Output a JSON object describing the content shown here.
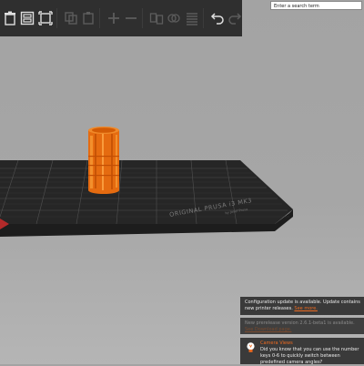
{
  "toolbar": {
    "buttons": [
      {
        "name": "delete-icon",
        "enabled": true
      },
      {
        "name": "delete-all-icon",
        "enabled": true
      },
      {
        "name": "arrange-icon",
        "enabled": true
      },
      {
        "name": "copy-icon",
        "enabled": false
      },
      {
        "name": "paste-icon",
        "enabled": false
      },
      {
        "name": "add-instance-icon",
        "enabled": false
      },
      {
        "name": "remove-instance-icon",
        "enabled": false
      },
      {
        "name": "split-objects-icon",
        "enabled": false
      },
      {
        "name": "split-parts-icon",
        "enabled": false
      },
      {
        "name": "layers-editing-icon",
        "enabled": false
      },
      {
        "name": "undo-icon",
        "enabled": true
      },
      {
        "name": "redo-icon",
        "enabled": false
      }
    ]
  },
  "search": {
    "placeholder": "Enter a search term"
  },
  "bed": {
    "label_main": "ORIGINAL PRUSA i3 MK3",
    "label_sub": "by Josef Prusa"
  },
  "notifications": [
    {
      "text": "Configuration update is available. Update contains new printer releases.",
      "link": "See more."
    },
    {
      "text": "New prerelease version 2.6.1-beta1 is available.",
      "link": "See Download page."
    },
    {
      "title": "Camera Views",
      "text": "Did you know that you can use the number keys 0-6 to quickly switch between predefined camera angles?"
    }
  ],
  "colors": {
    "accent": "#ed6b21",
    "toolbar_bg": "#2f2f2f",
    "viewport_bg": "#a6a6a6",
    "notification_bg": "#3a3a3a"
  }
}
